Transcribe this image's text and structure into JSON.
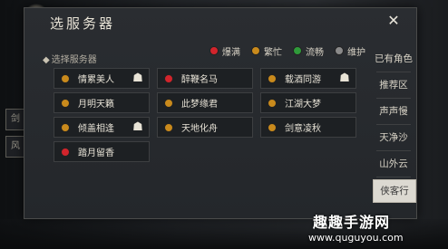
{
  "dialog": {
    "title": "选服务器",
    "close_icon": "close-icon"
  },
  "legend": [
    {
      "label": "爆满",
      "color": "#d2242c"
    },
    {
      "label": "繁忙",
      "color": "#c98a1c"
    },
    {
      "label": "流畅",
      "color": "#2f9a3a"
    },
    {
      "label": "维护",
      "color": "#8a8a8a"
    }
  ],
  "section_label": "选择服务器",
  "servers": [
    {
      "name": "情累美人",
      "status_color": "#c98a1c",
      "has_role": true
    },
    {
      "name": "醉鞭名马",
      "status_color": "#d2242c",
      "has_role": false
    },
    {
      "name": "载酒同游",
      "status_color": "#c98a1c",
      "has_role": true
    },
    {
      "name": "月明天籁",
      "status_color": "#c98a1c",
      "has_role": false
    },
    {
      "name": "此梦缘君",
      "status_color": "#c98a1c",
      "has_role": false
    },
    {
      "name": "江湖大梦",
      "status_color": "#c98a1c",
      "has_role": false
    },
    {
      "name": "倾盖相逢",
      "status_color": "#c98a1c",
      "has_role": true
    },
    {
      "name": "天地化舟",
      "status_color": "#c98a1c",
      "has_role": false
    },
    {
      "name": "剑意凌秋",
      "status_color": "#c98a1c",
      "has_role": false
    },
    {
      "name": "踏月留香",
      "status_color": "#d2242c",
      "has_role": false
    }
  ],
  "tabs": [
    {
      "label": "已有角色",
      "active": false
    },
    {
      "label": "推荐区",
      "active": false
    },
    {
      "label": "声声慢",
      "active": false
    },
    {
      "label": "天净沙",
      "active": false
    },
    {
      "label": "山外云",
      "active": false
    },
    {
      "label": "侠客行",
      "active": true
    }
  ],
  "side_deco": [
    "剑",
    "风"
  ],
  "watermark": {
    "title": "趣趣手游网",
    "url": "www.quguyou.com"
  }
}
